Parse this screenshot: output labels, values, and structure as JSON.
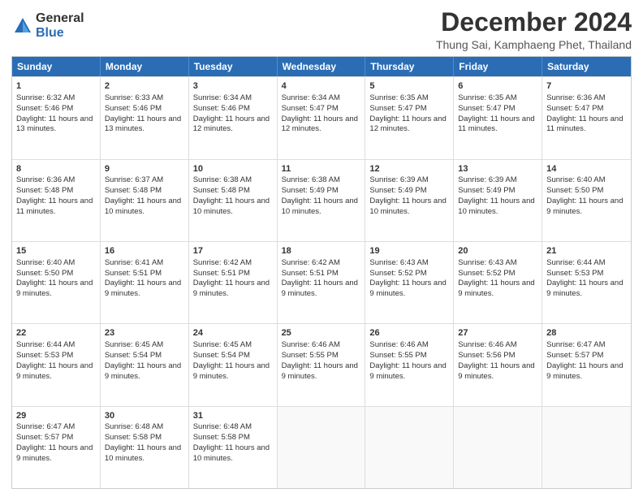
{
  "logo": {
    "general": "General",
    "blue": "Blue"
  },
  "title": {
    "month": "December 2024",
    "location": "Thung Sai, Kamphaeng Phet, Thailand"
  },
  "calendar": {
    "headers": [
      "Sunday",
      "Monday",
      "Tuesday",
      "Wednesday",
      "Thursday",
      "Friday",
      "Saturday"
    ],
    "rows": [
      [
        {
          "day": "1",
          "sunrise": "Sunrise: 6:32 AM",
          "sunset": "Sunset: 5:46 PM",
          "daylight": "Daylight: 11 hours and 13 minutes."
        },
        {
          "day": "2",
          "sunrise": "Sunrise: 6:33 AM",
          "sunset": "Sunset: 5:46 PM",
          "daylight": "Daylight: 11 hours and 13 minutes."
        },
        {
          "day": "3",
          "sunrise": "Sunrise: 6:34 AM",
          "sunset": "Sunset: 5:46 PM",
          "daylight": "Daylight: 11 hours and 12 minutes."
        },
        {
          "day": "4",
          "sunrise": "Sunrise: 6:34 AM",
          "sunset": "Sunset: 5:47 PM",
          "daylight": "Daylight: 11 hours and 12 minutes."
        },
        {
          "day": "5",
          "sunrise": "Sunrise: 6:35 AM",
          "sunset": "Sunset: 5:47 PM",
          "daylight": "Daylight: 11 hours and 12 minutes."
        },
        {
          "day": "6",
          "sunrise": "Sunrise: 6:35 AM",
          "sunset": "Sunset: 5:47 PM",
          "daylight": "Daylight: 11 hours and 11 minutes."
        },
        {
          "day": "7",
          "sunrise": "Sunrise: 6:36 AM",
          "sunset": "Sunset: 5:47 PM",
          "daylight": "Daylight: 11 hours and 11 minutes."
        }
      ],
      [
        {
          "day": "8",
          "sunrise": "Sunrise: 6:36 AM",
          "sunset": "Sunset: 5:48 PM",
          "daylight": "Daylight: 11 hours and 11 minutes."
        },
        {
          "day": "9",
          "sunrise": "Sunrise: 6:37 AM",
          "sunset": "Sunset: 5:48 PM",
          "daylight": "Daylight: 11 hours and 10 minutes."
        },
        {
          "day": "10",
          "sunrise": "Sunrise: 6:38 AM",
          "sunset": "Sunset: 5:48 PM",
          "daylight": "Daylight: 11 hours and 10 minutes."
        },
        {
          "day": "11",
          "sunrise": "Sunrise: 6:38 AM",
          "sunset": "Sunset: 5:49 PM",
          "daylight": "Daylight: 11 hours and 10 minutes."
        },
        {
          "day": "12",
          "sunrise": "Sunrise: 6:39 AM",
          "sunset": "Sunset: 5:49 PM",
          "daylight": "Daylight: 11 hours and 10 minutes."
        },
        {
          "day": "13",
          "sunrise": "Sunrise: 6:39 AM",
          "sunset": "Sunset: 5:49 PM",
          "daylight": "Daylight: 11 hours and 10 minutes."
        },
        {
          "day": "14",
          "sunrise": "Sunrise: 6:40 AM",
          "sunset": "Sunset: 5:50 PM",
          "daylight": "Daylight: 11 hours and 9 minutes."
        }
      ],
      [
        {
          "day": "15",
          "sunrise": "Sunrise: 6:40 AM",
          "sunset": "Sunset: 5:50 PM",
          "daylight": "Daylight: 11 hours and 9 minutes."
        },
        {
          "day": "16",
          "sunrise": "Sunrise: 6:41 AM",
          "sunset": "Sunset: 5:51 PM",
          "daylight": "Daylight: 11 hours and 9 minutes."
        },
        {
          "day": "17",
          "sunrise": "Sunrise: 6:42 AM",
          "sunset": "Sunset: 5:51 PM",
          "daylight": "Daylight: 11 hours and 9 minutes."
        },
        {
          "day": "18",
          "sunrise": "Sunrise: 6:42 AM",
          "sunset": "Sunset: 5:51 PM",
          "daylight": "Daylight: 11 hours and 9 minutes."
        },
        {
          "day": "19",
          "sunrise": "Sunrise: 6:43 AM",
          "sunset": "Sunset: 5:52 PM",
          "daylight": "Daylight: 11 hours and 9 minutes."
        },
        {
          "day": "20",
          "sunrise": "Sunrise: 6:43 AM",
          "sunset": "Sunset: 5:52 PM",
          "daylight": "Daylight: 11 hours and 9 minutes."
        },
        {
          "day": "21",
          "sunrise": "Sunrise: 6:44 AM",
          "sunset": "Sunset: 5:53 PM",
          "daylight": "Daylight: 11 hours and 9 minutes."
        }
      ],
      [
        {
          "day": "22",
          "sunrise": "Sunrise: 6:44 AM",
          "sunset": "Sunset: 5:53 PM",
          "daylight": "Daylight: 11 hours and 9 minutes."
        },
        {
          "day": "23",
          "sunrise": "Sunrise: 6:45 AM",
          "sunset": "Sunset: 5:54 PM",
          "daylight": "Daylight: 11 hours and 9 minutes."
        },
        {
          "day": "24",
          "sunrise": "Sunrise: 6:45 AM",
          "sunset": "Sunset: 5:54 PM",
          "daylight": "Daylight: 11 hours and 9 minutes."
        },
        {
          "day": "25",
          "sunrise": "Sunrise: 6:46 AM",
          "sunset": "Sunset: 5:55 PM",
          "daylight": "Daylight: 11 hours and 9 minutes."
        },
        {
          "day": "26",
          "sunrise": "Sunrise: 6:46 AM",
          "sunset": "Sunset: 5:55 PM",
          "daylight": "Daylight: 11 hours and 9 minutes."
        },
        {
          "day": "27",
          "sunrise": "Sunrise: 6:46 AM",
          "sunset": "Sunset: 5:56 PM",
          "daylight": "Daylight: 11 hours and 9 minutes."
        },
        {
          "day": "28",
          "sunrise": "Sunrise: 6:47 AM",
          "sunset": "Sunset: 5:57 PM",
          "daylight": "Daylight: 11 hours and 9 minutes."
        }
      ],
      [
        {
          "day": "29",
          "sunrise": "Sunrise: 6:47 AM",
          "sunset": "Sunset: 5:57 PM",
          "daylight": "Daylight: 11 hours and 9 minutes."
        },
        {
          "day": "30",
          "sunrise": "Sunrise: 6:48 AM",
          "sunset": "Sunset: 5:58 PM",
          "daylight": "Daylight: 11 hours and 10 minutes."
        },
        {
          "day": "31",
          "sunrise": "Sunrise: 6:48 AM",
          "sunset": "Sunset: 5:58 PM",
          "daylight": "Daylight: 11 hours and 10 minutes."
        },
        null,
        null,
        null,
        null
      ]
    ]
  }
}
